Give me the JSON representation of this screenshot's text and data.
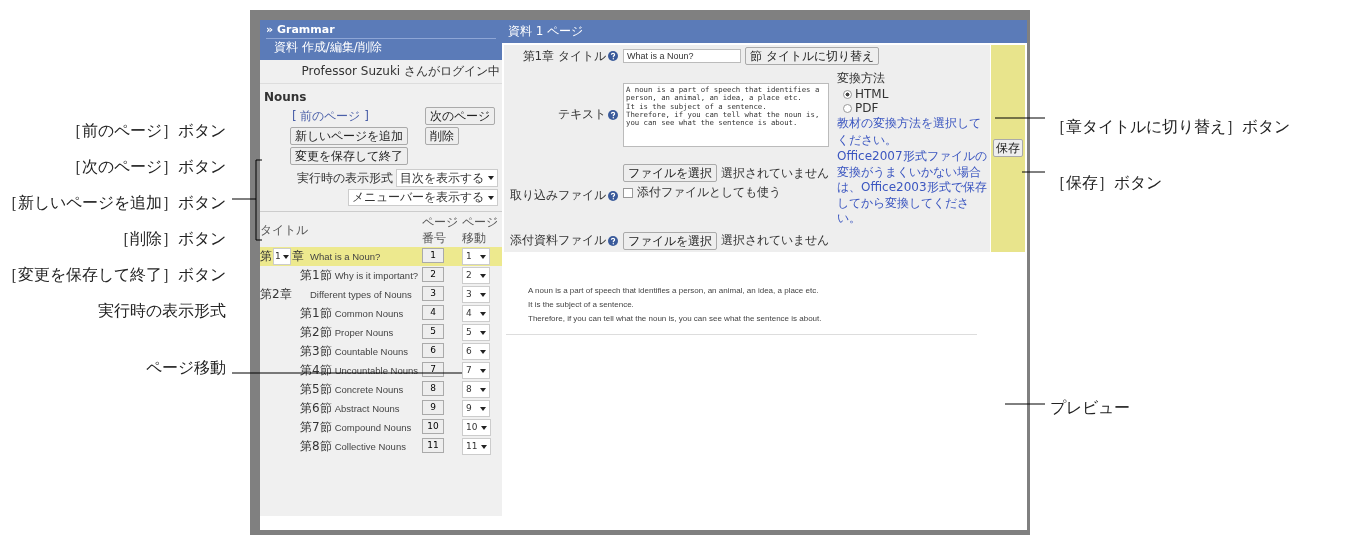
{
  "callouts_left": [
    "［前のページ］ボタン",
    "［次のページ］ボタン",
    "［新しいページを追加］ボタン",
    "［削除］ボタン",
    "［変更を保存して終了］ボタン",
    "実行時の表示形式",
    "ページ移動"
  ],
  "callouts_right": [
    "［章タイトルに切り替え］ボタン",
    "［保存］ボタン",
    "プレビュー"
  ],
  "sidebar": {
    "title": "» Grammar",
    "subtitle": "資料 作成/編集/削除",
    "login": "Professor Suzuki さんがログイン中",
    "section_title": "Nouns",
    "prev_page_link": "[ 前のページ ]",
    "next_page_button": "次のページ",
    "add_page_button": "新しいページを追加",
    "delete_button": "削除",
    "save_exit_button": "変更を保存して終了",
    "display_format": {
      "label": "実行時の表示形式",
      "selects": [
        "目次を表示する",
        "メニューバーを表示する"
      ]
    },
    "table": {
      "columns": [
        "タイトル",
        "ページ番号",
        "ページ移動"
      ],
      "rows": [
        {
          "kind": "chapter",
          "chapter_select": {
            "prefix": "第",
            "value": "1",
            "suffix": "章"
          },
          "title": "What is a Noun?",
          "page": "1",
          "move": "1",
          "selected": true,
          "children": [
            {
              "kind": "section",
              "label": "第1節",
              "title": "Why is it important?",
              "page": "2",
              "move": "2",
              "selected": false
            }
          ]
        },
        {
          "kind": "chapter",
          "label": "第2章",
          "title": "Different types of Nouns",
          "page": "3",
          "move": "3",
          "selected": false,
          "children": [
            {
              "kind": "section",
              "label": "第1節",
              "title": "Common Nouns",
              "page": "4",
              "move": "4",
              "selected": false
            },
            {
              "kind": "section",
              "label": "第2節",
              "title": "Proper Nouns",
              "page": "5",
              "move": "5",
              "selected": false
            },
            {
              "kind": "section",
              "label": "第3節",
              "title": "Countable Nouns",
              "page": "6",
              "move": "6",
              "selected": false
            },
            {
              "kind": "section",
              "label": "第4節",
              "title": "Uncountable Nouns",
              "page": "7",
              "move": "7",
              "selected": false
            },
            {
              "kind": "section",
              "label": "第5節",
              "title": "Concrete Nouns",
              "page": "8",
              "move": "8",
              "selected": false
            },
            {
              "kind": "section",
              "label": "第6節",
              "title": "Abstract Nouns",
              "page": "9",
              "move": "9",
              "selected": false
            },
            {
              "kind": "section",
              "label": "第7節",
              "title": "Compound Nouns",
              "page": "10",
              "move": "10",
              "selected": false
            },
            {
              "kind": "section",
              "label": "第8節",
              "title": "Collective Nouns",
              "page": "11",
              "move": "11",
              "selected": false
            }
          ]
        }
      ]
    }
  },
  "editor": {
    "header": "資料 1 ページ",
    "title_row": {
      "label": "第1章 タイトル",
      "value": "What is a Noun?",
      "button": "節 タイトルに切り替え"
    },
    "text_row": {
      "label": "テキスト",
      "value": "A noun is a part of speech that identifies a person, an animal, an idea, a place etc.\nIt is the subject of a sentence.\nTherefore, if you can tell what the noun is, you can see what the sentence is about."
    },
    "conversion": {
      "label": "変換方法",
      "options": [
        {
          "label": "HTML",
          "selected": true
        },
        {
          "label": "PDF",
          "selected": false
        }
      ],
      "note": "教材の変換方法を選択してください。",
      "warning": "Office2007形式ファイルの変換がうまくいかない場合は、Office2003形式で保存してから変換してください。"
    },
    "import_row": {
      "label": "取り込みファイル",
      "button": "ファイルを選択",
      "status": "選択されていません",
      "attach_checkbox": {
        "label": "添付ファイルとしても使う",
        "checked": false
      }
    },
    "attachment_row": {
      "label": "添付資料ファイル",
      "button": "ファイルを選択",
      "status": "選択されていません"
    },
    "save_button": "保存"
  },
  "preview": {
    "lines": [
      "A noun is a part of speech that identifies a person, an animal, an idea, a place etc.",
      "It is the subject of a sentence.",
      "Therefore, if you can tell what the noun is, you can see what the sentence is about."
    ]
  }
}
